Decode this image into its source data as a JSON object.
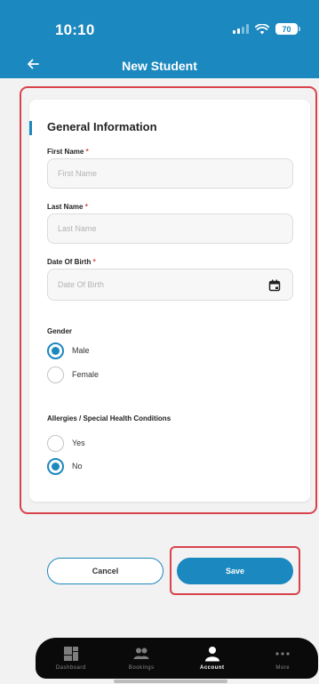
{
  "status_bar": {
    "time": "10:10",
    "battery": "70"
  },
  "nav": {
    "title": "New Student"
  },
  "form": {
    "section_title": "General Information",
    "first_name": {
      "label": "First Name",
      "required_mark": "*",
      "placeholder": "First Name",
      "value": ""
    },
    "last_name": {
      "label": "Last Name",
      "required_mark": "*",
      "placeholder": "Last Name",
      "value": ""
    },
    "date_of_birth": {
      "label": "Date Of Birth",
      "required_mark": "*",
      "placeholder": "Date Of Birth",
      "value": ""
    },
    "gender": {
      "label": "Gender",
      "options": [
        {
          "label": "Male",
          "selected": true
        },
        {
          "label": "Female",
          "selected": false
        }
      ]
    },
    "allergies": {
      "label": "Allergies / Special Health Conditions",
      "options": [
        {
          "label": "Yes",
          "selected": false
        },
        {
          "label": "No",
          "selected": true
        }
      ]
    }
  },
  "actions": {
    "cancel_label": "Cancel",
    "save_label": "Save"
  },
  "tab_bar": {
    "items": [
      {
        "label": "Dashboard",
        "icon": "dashboard-icon",
        "active": false
      },
      {
        "label": "Bookings",
        "icon": "people-icon",
        "active": false
      },
      {
        "label": "Account",
        "icon": "person-icon",
        "active": true
      },
      {
        "label": "More",
        "icon": "more-dots-icon",
        "active": false
      }
    ]
  },
  "colors": {
    "primary": "#1b88bf",
    "highlight": "#d9434b",
    "tab_bar": "#0a0a0a"
  }
}
